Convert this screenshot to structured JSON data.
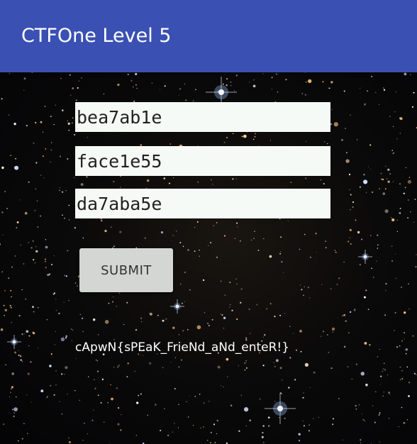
{
  "app_bar": {
    "title": "CTFOne Level 5",
    "color": "#3a50b3"
  },
  "form": {
    "field_1": "bea7ab1e",
    "field_2": "face1e55",
    "field_3": "da7aba5e",
    "submit_label": "SUBMIT"
  },
  "result": {
    "flag_text": "cApwN{sPEaK_FrieNd_aNd_enteR!}"
  },
  "background": {
    "description_icon": "starfield-background-image"
  }
}
